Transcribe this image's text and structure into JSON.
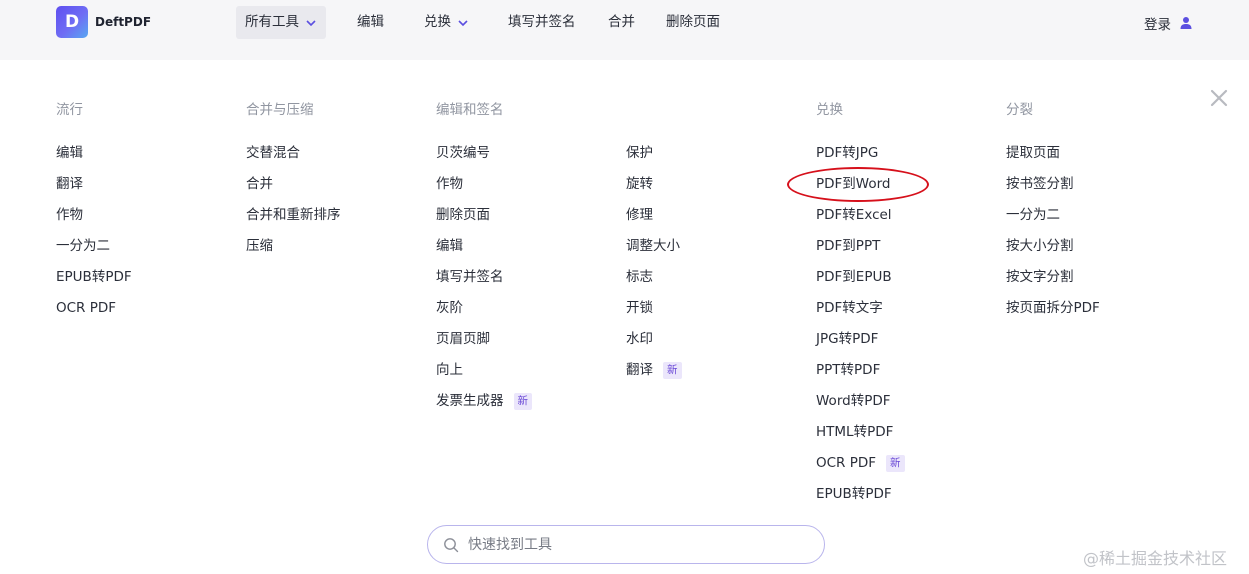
{
  "header": {
    "logo_letter": "D",
    "logo_text": "DeftPDF",
    "nav": [
      {
        "label": "所有工具"
      },
      {
        "label": "编辑"
      },
      {
        "label": "兑换"
      },
      {
        "label": "填写并签名"
      },
      {
        "label": "合并"
      },
      {
        "label": "删除页面"
      }
    ],
    "login_label": "登录"
  },
  "menu": {
    "badge_label": "新",
    "columns": [
      {
        "heading": "流行",
        "items": [
          "编辑",
          "翻译",
          "作物",
          "一分为二",
          "EPUB转PDF",
          "OCR PDF"
        ]
      },
      {
        "heading": "合并与压缩",
        "items": [
          "交替混合",
          "合并",
          "合并和重新排序",
          "压缩"
        ]
      },
      {
        "heading": "编辑和签名",
        "items": [
          "贝茨编号",
          "作物",
          "删除页面",
          "编辑",
          "填写并签名",
          "灰阶",
          "页眉页脚",
          "向上",
          "发票生成器"
        ]
      },
      {
        "heading": "",
        "items": [
          "保护",
          "旋转",
          "修理",
          "调整大小",
          "标志",
          "开锁",
          "水印",
          "翻译"
        ]
      },
      {
        "heading": "兑换",
        "items": [
          "PDF转JPG",
          "PDF到Word",
          "PDF转Excel",
          "PDF到PPT",
          "PDF到EPUB",
          "PDF转文字",
          "JPG转PDF",
          "PPT转PDF",
          "Word转PDF",
          "HTML转PDF",
          "OCR PDF",
          "EPUB转PDF"
        ]
      },
      {
        "heading": "分裂",
        "items": [
          "提取页面",
          "按书签分割",
          "一分为二",
          "按大小分割",
          "按文字分割",
          "按页面拆分PDF"
        ]
      }
    ]
  },
  "search": {
    "placeholder": "快速找到工具",
    "value": ""
  },
  "watermark": "@稀土掘金技术社区",
  "colors": {
    "accent": "#6a5af0",
    "annotation": "#d6101b"
  }
}
